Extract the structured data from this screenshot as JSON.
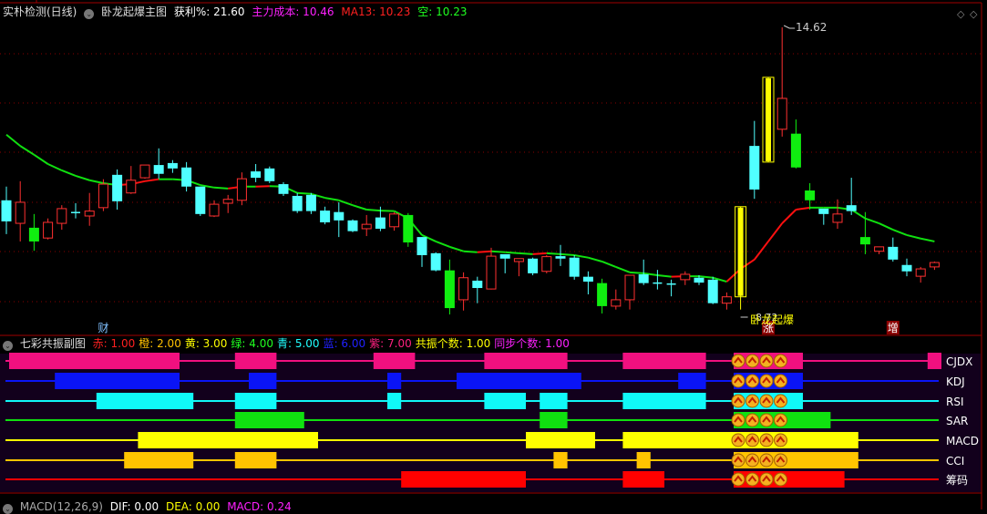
{
  "main_header": {
    "stock": "实朴检测(日线)",
    "indicator": "卧龙起爆主图",
    "profit_label": "获利%: 21.60",
    "cost_label": "主力成本: 10.46",
    "ma_label": "MA13: 10.23",
    "empty_label": "空: 10.23"
  },
  "sub_header": {
    "indicator": "七彩共振副图",
    "items": [
      {
        "text": "赤: 1.00",
        "color": "#ff2020"
      },
      {
        "text": "橙: 2.00",
        "color": "#ffc000"
      },
      {
        "text": "黄: 3.00",
        "color": "#ffff00"
      },
      {
        "text": "绿: 4.00",
        "color": "#20ff20"
      },
      {
        "text": "青: 5.00",
        "color": "#20ffff"
      },
      {
        "text": "蓝: 6.00",
        "color": "#2020ff"
      },
      {
        "text": "紫: 7.00",
        "color": "#ff2080"
      },
      {
        "text": "共振个数: 1.00",
        "color": "#ffff00"
      },
      {
        "text": "同步个数: 1.00",
        "color": "#ff20ff"
      }
    ]
  },
  "bottom_header": {
    "indicator": "MACD(12,26,9)",
    "dif": "DIF: 0.00",
    "dea": "DEA: 0.00",
    "macd": "MACD: 0.24"
  },
  "annotations": {
    "high_price": "14.62",
    "low_price": "8.72",
    "signal_label": "卧龙起爆",
    "marker_cai": "财",
    "marker_zhang": "涨",
    "marker_zeng": "增"
  },
  "chart_data": {
    "type": "candlestick",
    "price_range": [
      8.72,
      14.62
    ],
    "candles": [
      [
        11.09,
        10.66,
        11.37,
        10.4
      ],
      [
        10.62,
        11.05,
        11.48,
        10.25
      ],
      [
        10.53,
        10.25,
        10.81,
        10.06
      ],
      [
        10.32,
        10.64,
        10.72,
        10.29
      ],
      [
        10.62,
        10.92,
        10.99,
        10.49
      ],
      [
        10.84,
        10.84,
        11.03,
        10.72
      ],
      [
        10.77,
        10.87,
        11.24,
        10.57
      ],
      [
        10.94,
        11.42,
        11.52,
        10.87
      ],
      [
        11.61,
        11.07,
        11.72,
        10.9
      ],
      [
        11.24,
        11.5,
        11.79,
        11.22
      ],
      [
        11.55,
        11.81,
        11.81,
        11.53
      ],
      [
        11.81,
        11.63,
        12.15,
        11.53
      ],
      [
        11.85,
        11.74,
        11.91,
        11.65
      ],
      [
        11.76,
        11.37,
        11.87,
        11.27
      ],
      [
        11.37,
        10.81,
        11.37,
        10.77
      ],
      [
        10.77,
        11.01,
        11.09,
        10.75
      ],
      [
        11.03,
        11.11,
        11.2,
        10.83
      ],
      [
        11.09,
        11.53,
        11.66,
        10.99
      ],
      [
        11.68,
        11.55,
        11.83,
        11.46
      ],
      [
        11.74,
        11.48,
        11.78,
        11.44
      ],
      [
        11.42,
        11.22,
        11.46,
        11.18
      ],
      [
        11.18,
        10.87,
        11.24,
        10.83
      ],
      [
        11.2,
        10.87,
        11.24,
        10.81
      ],
      [
        10.88,
        10.64,
        10.96,
        10.6
      ],
      [
        10.85,
        10.68,
        11.05,
        10.34
      ],
      [
        10.68,
        10.46,
        10.7,
        10.44
      ],
      [
        10.51,
        10.6,
        10.79,
        10.36
      ],
      [
        10.74,
        10.51,
        10.96,
        10.46
      ],
      [
        10.55,
        10.81,
        10.85,
        10.47
      ],
      [
        10.79,
        10.23,
        10.83,
        10.14
      ],
      [
        10.34,
        9.97,
        10.34,
        9.73
      ],
      [
        10.01,
        9.66,
        10.03,
        9.64
      ],
      [
        9.66,
        8.89,
        9.88,
        8.76
      ],
      [
        9.06,
        9.51,
        9.62,
        8.84
      ],
      [
        9.45,
        9.3,
        9.53,
        8.99
      ],
      [
        9.28,
        9.95,
        10.12,
        9.27
      ],
      [
        9.99,
        9.9,
        9.99,
        9.6
      ],
      [
        9.84,
        9.9,
        9.9,
        9.54
      ],
      [
        9.9,
        9.6,
        9.92,
        9.56
      ],
      [
        9.64,
        9.94,
        9.97,
        9.6
      ],
      [
        9.95,
        9.9,
        10.18,
        9.75
      ],
      [
        9.92,
        9.53,
        9.97,
        9.47
      ],
      [
        9.53,
        9.43,
        9.64,
        9.17
      ],
      [
        9.4,
        8.93,
        9.49,
        8.78
      ],
      [
        8.93,
        9.06,
        9.27,
        8.86
      ],
      [
        9.06,
        9.56,
        9.56,
        8.86
      ],
      [
        9.58,
        9.4,
        9.88,
        9.36
      ],
      [
        9.4,
        9.4,
        9.67,
        9.27
      ],
      [
        9.38,
        9.38,
        9.47,
        9.13
      ],
      [
        9.47,
        9.58,
        9.64,
        9.36
      ],
      [
        9.51,
        9.41,
        9.56,
        9.36
      ],
      [
        9.47,
        8.99,
        9.53,
        8.97
      ],
      [
        8.99,
        9.12,
        9.21,
        8.86
      ],
      [
        9.12,
        10.96,
        10.96,
        8.86
      ],
      [
        12.2,
        11.31,
        12.71,
        11.12
      ],
      [
        11.87,
        13.6,
        13.6,
        11.87
      ],
      [
        12.54,
        13.17,
        14.62,
        12.39
      ],
      [
        12.45,
        11.76,
        12.74,
        11.74
      ],
      [
        11.29,
        11.09,
        11.44,
        10.9
      ],
      [
        10.92,
        10.81,
        10.92,
        10.59
      ],
      [
        10.64,
        10.81,
        11.11,
        10.51
      ],
      [
        10.99,
        10.87,
        11.55,
        10.79
      ],
      [
        10.34,
        10.19,
        10.85,
        9.99
      ],
      [
        10.05,
        10.14,
        10.14,
        9.99
      ],
      [
        10.14,
        9.88,
        10.33,
        9.84
      ],
      [
        9.77,
        9.64,
        9.9,
        9.54
      ],
      [
        9.54,
        9.69,
        9.73,
        9.41
      ],
      [
        9.73,
        9.82,
        9.84,
        9.67
      ]
    ],
    "big_down_candles": [
      3,
      30,
      33,
      44,
      58,
      59,
      63
    ],
    "signal_candles": [
      54,
      56
    ],
    "ma13": [
      12.43,
      12.2,
      12.02,
      11.83,
      11.7,
      11.59,
      11.5,
      11.44,
      11.4,
      11.42,
      11.48,
      11.52,
      11.52,
      11.5,
      11.4,
      11.35,
      11.33,
      11.37,
      11.37,
      11.38,
      11.37,
      11.24,
      11.22,
      11.14,
      11.09,
      10.99,
      10.9,
      10.88,
      10.87,
      10.72,
      10.38,
      10.25,
      10.14,
      10.05,
      10.03,
      10.05,
      10.03,
      10.01,
      9.99,
      10.01,
      9.99,
      9.97,
      9.92,
      9.84,
      9.73,
      9.62,
      9.6,
      9.56,
      9.53,
      9.54,
      9.54,
      9.51,
      9.43,
      9.69,
      9.88,
      10.25,
      10.62,
      10.9,
      10.94,
      10.94,
      10.94,
      10.9,
      10.72,
      10.62,
      10.49,
      10.38,
      10.31,
      10.25
    ],
    "markers": [
      {
        "candle": 8,
        "text_key": "marker_cai",
        "boxed": false
      },
      {
        "candle": 56,
        "text_key": "marker_zhang",
        "boxed": true
      },
      {
        "candle": 65,
        "text_key": "marker_zeng",
        "boxed": true
      }
    ],
    "resonance_rows": [
      {
        "name": "CJDX",
        "color": "#f0107f",
        "segments": [
          [
            1,
            13
          ],
          [
            18,
            20
          ],
          [
            28,
            30
          ],
          [
            36,
            41
          ],
          [
            46,
            51
          ],
          [
            54,
            58
          ],
          [
            68,
            68
          ]
        ]
      },
      {
        "name": "KDJ",
        "color": "#0a14f5",
        "segments": [
          [
            5,
            13
          ],
          [
            19,
            20
          ],
          [
            29,
            29
          ],
          [
            34,
            42
          ],
          [
            50,
            51
          ],
          [
            54,
            58
          ]
        ]
      },
      {
        "name": "RSI",
        "color": "#10f8f8",
        "segments": [
          [
            8,
            14
          ],
          [
            18,
            20
          ],
          [
            29,
            29
          ],
          [
            36,
            38
          ],
          [
            40,
            41
          ],
          [
            46,
            51
          ],
          [
            54,
            58
          ]
        ]
      },
      {
        "name": "SAR",
        "color": "#10e010",
        "segments": [
          [
            18,
            22
          ],
          [
            40,
            41
          ],
          [
            54,
            60
          ]
        ]
      },
      {
        "name": "MACD",
        "color": "#ffff00",
        "segments": [
          [
            11,
            23
          ],
          [
            39,
            43
          ],
          [
            46,
            62
          ]
        ]
      },
      {
        "name": "CCI",
        "color": "#ffc400",
        "segments": [
          [
            10,
            14
          ],
          [
            18,
            20
          ],
          [
            41,
            41
          ],
          [
            47,
            47
          ],
          [
            54,
            62
          ]
        ]
      },
      {
        "name": "筹码",
        "color": "#ff0000",
        "segments": [
          [
            30,
            38
          ],
          [
            46,
            48
          ],
          [
            54,
            61
          ]
        ]
      }
    ],
    "resonance_icon_candles": [
      54,
      55,
      56,
      57
    ]
  }
}
